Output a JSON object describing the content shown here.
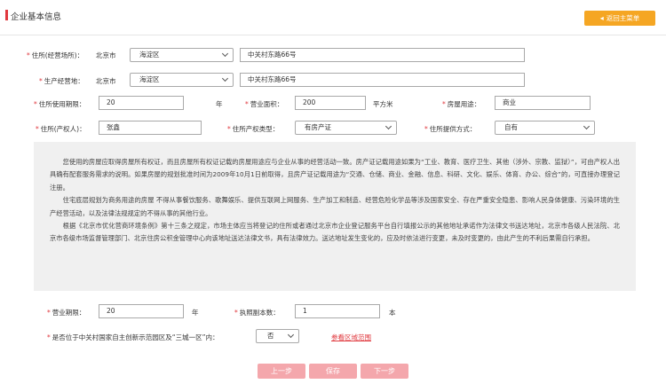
{
  "header": {
    "title": "企业基本信息",
    "back_label": "返回主菜单",
    "back_icon": "arrow-left-icon"
  },
  "address": {
    "residence_label": "住所(经营场所)：",
    "residence_city": "北京市",
    "residence_district": "海淀区",
    "residence_street": "中关村东路66号",
    "business_label": "生产经营地：",
    "business_city": "北京市",
    "business_district": "海淀区",
    "business_street": "中关村东路66号"
  },
  "property": {
    "term_label": "住所使用期限：",
    "term_value": "20",
    "term_unit": "年",
    "area_label": "营业面积：",
    "area_value": "200",
    "area_unit": "平方米",
    "usage_label": "房屋用途：",
    "usage_value": "商业",
    "owner_label": "住所(产权人)：",
    "owner_value": "张鑫",
    "type_label": "住所产权类型：",
    "type_value": "有房产证",
    "provide_label": "住所提供方式：",
    "provide_value": "自有"
  },
  "notice": {
    "p1": "您使用的房屋应取得房屋所有权证，而且房屋所有权证记载的房屋用途应与企业从事的经营活动一致。房产证记载用途如果为“工业、教育、医疗卫生、其他（涉外、宗教、监狱）”，可由产权人出具确有配套服务需求的说明。如果房屋的规划批准时间为2009年10月1日前取得，且房产证记载用途为“交通、仓储、商业、金融、信息、科研、文化、娱乐、体育、办公、综合”的，可直接办理登记注册。",
    "p2": "住宅底层规划为商务用途的房屋 不得从事餐饮服务、歌舞娱乐、提供互联网上网服务、生产加工和制造、经营危险化学品等涉及国家安全、存在严重安全隐患、影响人民身体健康、污染环境的生产经营活动，以及法律法规规定的不得从事的其他行业。",
    "p3": "根据《北京市优化营商环境条例》第十三条之规定，市场主体应当将登记的住所或者通过北京市企业登记服务平台自行填报公示的其他地址承诺作为法律文书送达地址，北京市各级人民法院、北京市各级市场监督管理部门、北京住房公积金管理中心向该地址送达法律文书，具有法律效力。送达地址发生变化的，应及时依法进行变更，未及时变更的，由此产生的不利后果需自行承担。"
  },
  "bottom": {
    "period_label": "营业期限：",
    "period_value": "20",
    "period_unit": "年",
    "copies_label": "执照副本数：",
    "copies_value": "1",
    "copies_unit": "本",
    "zone_label": "是否位于中关村国家自主创新示范园区及“三城一区”内：",
    "zone_value": "否",
    "zone_link": "参看区域范围"
  },
  "actions": {
    "prev": "上一步",
    "save": "保存",
    "next": "下一步"
  },
  "colors": {
    "accent": "#e0383e",
    "back_button": "#f5a623",
    "action_button": "#f4a7ac"
  }
}
